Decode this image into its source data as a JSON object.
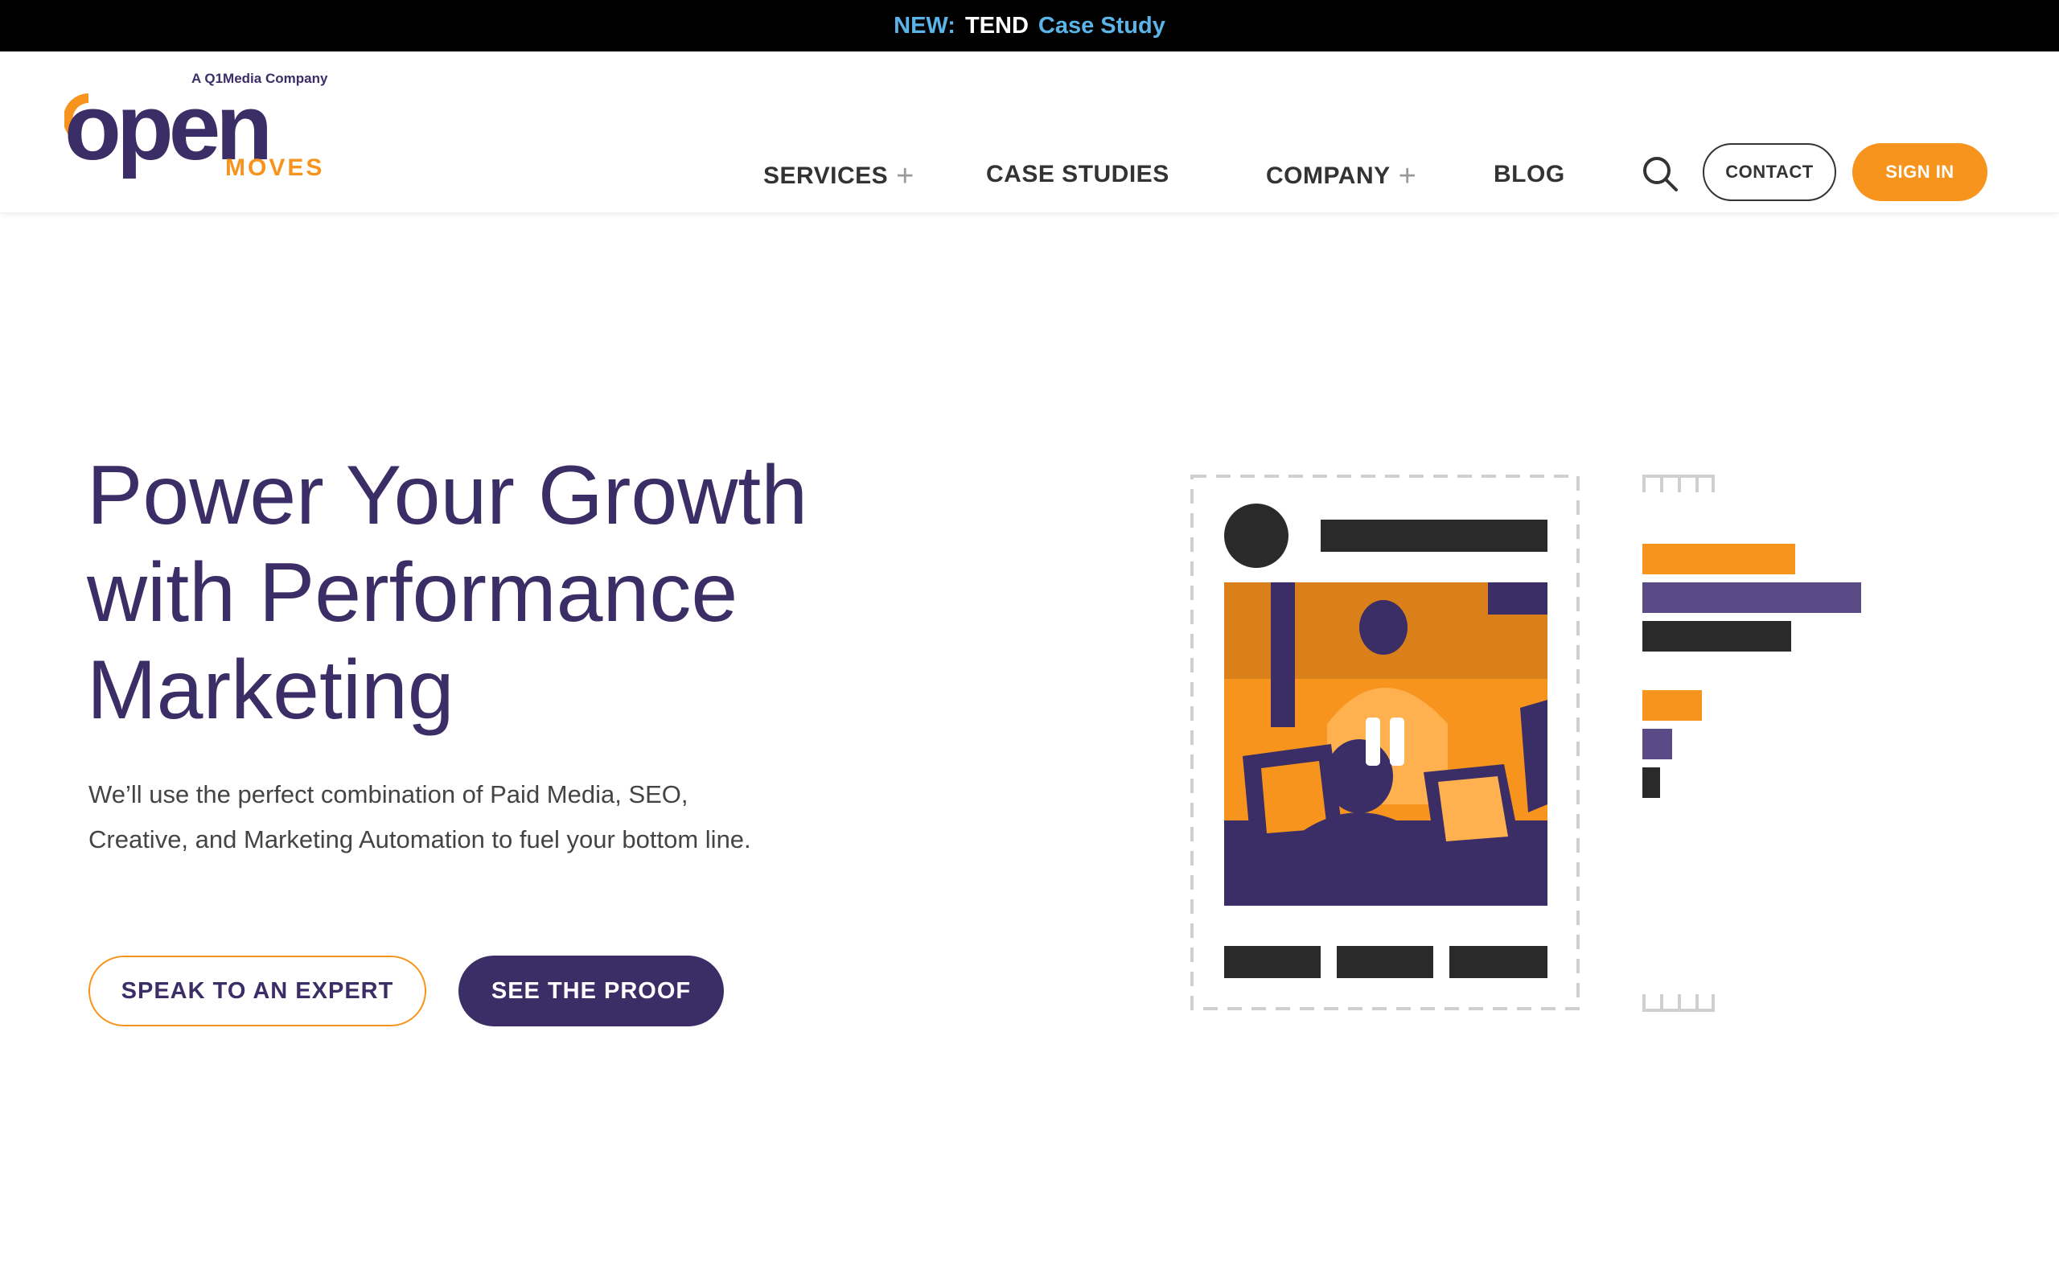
{
  "announcement": {
    "prefix": "NEW:",
    "brand": "TEND",
    "link": "Case Study"
  },
  "logo": {
    "tagline": "A Q1Media Company",
    "word": "open",
    "sub": "MOVES"
  },
  "nav": {
    "items": [
      {
        "label": "SERVICES",
        "has_submenu": true
      },
      {
        "label": "CASE STUDIES",
        "has_submenu": false
      },
      {
        "label": "COMPANY",
        "has_submenu": true
      },
      {
        "label": "BLOG",
        "has_submenu": false
      }
    ],
    "plus_glyph": "+",
    "search_icon": "search-icon",
    "contact_label": "CONTACT",
    "signin_label": "SIGN IN"
  },
  "hero": {
    "title_lines": [
      "Power Your Growth",
      "with Performance",
      "Marketing"
    ],
    "subtitle_lines": [
      "We’ll use the perfect combination of Paid Media, SEO,",
      "Creative, and Marketing Automation to fuel your bottom line."
    ],
    "primary_cta": "SPEAK TO AN EXPERT",
    "secondary_cta": "SEE THE PROOF"
  },
  "illustration": {
    "video_state": "paused",
    "bars_large": [
      0.7,
      1.0,
      0.68
    ],
    "bars_small": [
      1.0,
      0.5,
      0.3
    ]
  },
  "colors": {
    "brand_purple": "#3b2d66",
    "brand_orange": "#f7941d",
    "announcement_blue": "#5ab4e8",
    "dark": "#2a2a2a"
  }
}
